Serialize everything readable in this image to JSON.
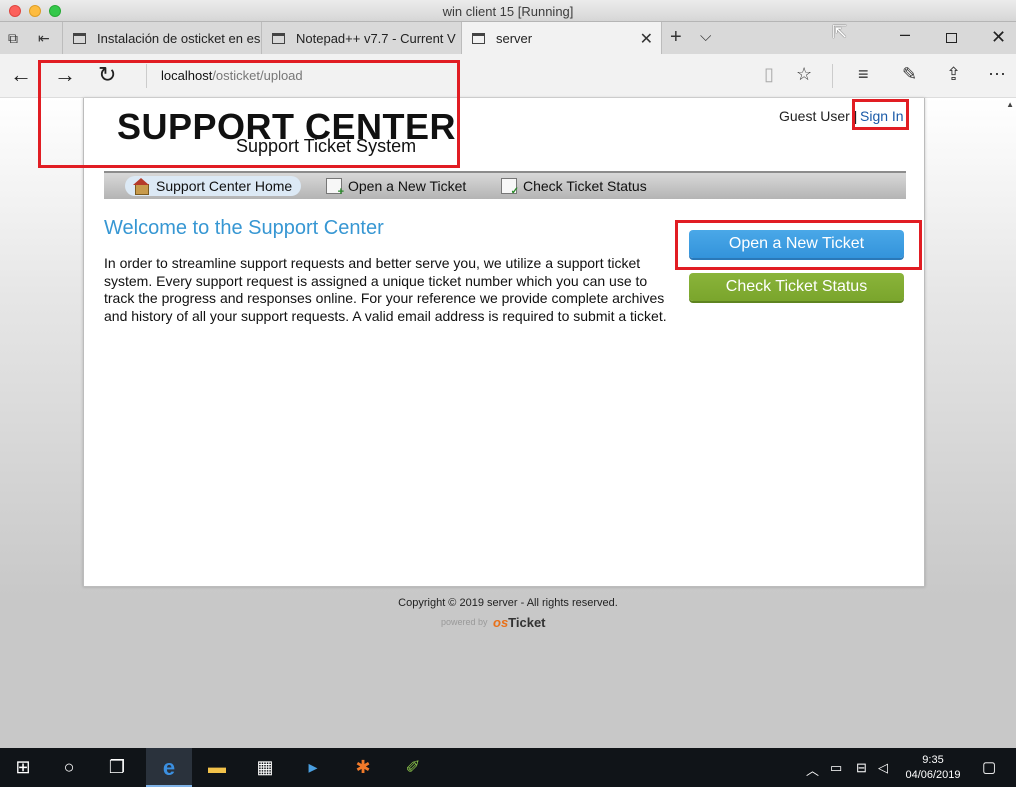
{
  "mac_window": {
    "title": "win client 15 [Running]"
  },
  "browser": {
    "tabs": [
      {
        "label": "Instalación de osticket en es"
      },
      {
        "label": "Notepad++ v7.7 - Current V"
      },
      {
        "label": "server"
      }
    ],
    "address": {
      "host": "localhost",
      "path": "/osticket/upload"
    }
  },
  "page": {
    "logo": {
      "title": "SUPPORT CENTER",
      "subtitle": "Support Ticket System"
    },
    "user": {
      "guest_label": "Guest User |",
      "sign_in": "Sign In"
    },
    "nav": [
      {
        "label": "Support Center Home"
      },
      {
        "label": "Open a New Ticket"
      },
      {
        "label": "Check Ticket Status"
      }
    ],
    "welcome_title": "Welcome to the Support Center",
    "intro_text": "In order to streamline support requests and better serve you, we utilize a support ticket system. Every support request is assigned a unique ticket number which you can use to track the progress and responses online. For your reference we provide complete archives and history of all your support requests. A valid email address is required to submit a ticket.",
    "buttons": {
      "open_ticket": "Open a New Ticket",
      "check_status": "Check Ticket Status"
    },
    "footer": {
      "copyright": "Copyright © 2019 server - All rights reserved.",
      "powered_by": "powered by",
      "brand_os": "os",
      "brand_ticket": "Ticket"
    }
  },
  "taskbar": {
    "time": "9:35",
    "date": "04/06/2019"
  },
  "colors": {
    "accent": "#3797d3",
    "open_button": "#3393db",
    "check_button": "#7aa52c",
    "highlight_box": "#e11d23"
  }
}
